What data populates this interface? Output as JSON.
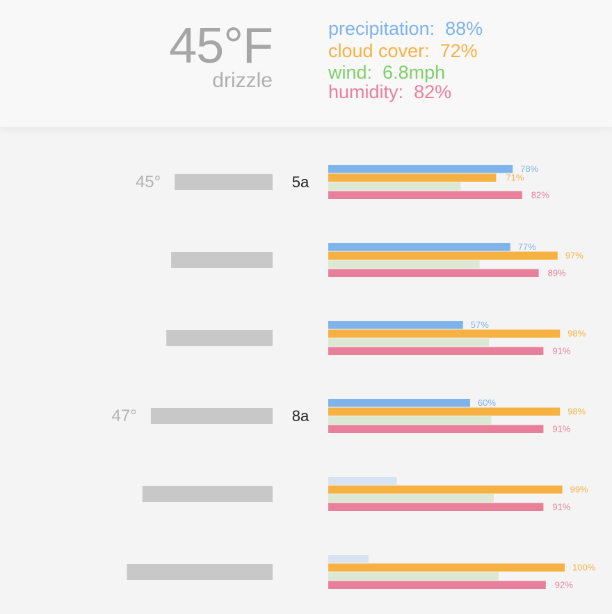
{
  "current": {
    "temperature": "45°F",
    "condition": "drizzle",
    "precipitation": {
      "label": "precipitation:",
      "value": "88%"
    },
    "cloud_cover": {
      "label": "cloud cover:",
      "value": "72%"
    },
    "wind": {
      "label": "wind:",
      "value": "6.8mph"
    },
    "humidity": {
      "label": "humidity:",
      "value": "82%"
    }
  },
  "colors": {
    "precipitation": "#7eb3ec",
    "precipitation_faint": "#d6e3f3",
    "cloud_cover": "#f6b142",
    "wind": "#dce8d2",
    "humidity": "#e8809c",
    "temp_bar": "#c8c8c8",
    "wind_text": "#7fcf6a"
  },
  "chart_data": {
    "type": "bar",
    "series_order": [
      "precipitation",
      "cloud_cover",
      "wind",
      "humidity"
    ],
    "rows": [
      {
        "hour": "5a",
        "temp_label": "45°",
        "temperature": 45,
        "precipitation": 78,
        "cloud_cover": 71,
        "wind": 0.56,
        "humidity": 82,
        "labels": {
          "precipitation": "78%",
          "cloud_cover": "71%",
          "humidity": "82%"
        }
      },
      {
        "hour": "",
        "temp_label": "",
        "temperature": 45.3,
        "precipitation": 77,
        "cloud_cover": 97,
        "wind": 0.64,
        "humidity": 89,
        "labels": {
          "precipitation": "77%",
          "cloud_cover": "97%",
          "humidity": "89%"
        }
      },
      {
        "hour": "",
        "temp_label": "",
        "temperature": 45.7,
        "precipitation": 57,
        "cloud_cover": 98,
        "wind": 0.68,
        "humidity": 91,
        "labels": {
          "precipitation": "57%",
          "cloud_cover": "98%",
          "humidity": "91%"
        }
      },
      {
        "hour": "8a",
        "temp_label": "47°",
        "temperature": 47,
        "precipitation": 60,
        "cloud_cover": 98,
        "wind": 0.69,
        "humidity": 91,
        "labels": {
          "precipitation": "60%",
          "cloud_cover": "98%",
          "humidity": "91%"
        }
      },
      {
        "hour": "",
        "temp_label": "",
        "temperature": 47.7,
        "precipitation": 29,
        "cloud_cover": 99,
        "wind": 0.7,
        "humidity": 91,
        "labels": {
          "precipitation": "",
          "cloud_cover": "99%",
          "humidity": "91%"
        }
      },
      {
        "hour": "",
        "temp_label": "",
        "temperature": 49,
        "precipitation": 17,
        "cloud_cover": 100,
        "wind": 0.72,
        "humidity": 92,
        "labels": {
          "precipitation": "",
          "cloud_cover": "100%",
          "humidity": "92%"
        }
      }
    ]
  }
}
